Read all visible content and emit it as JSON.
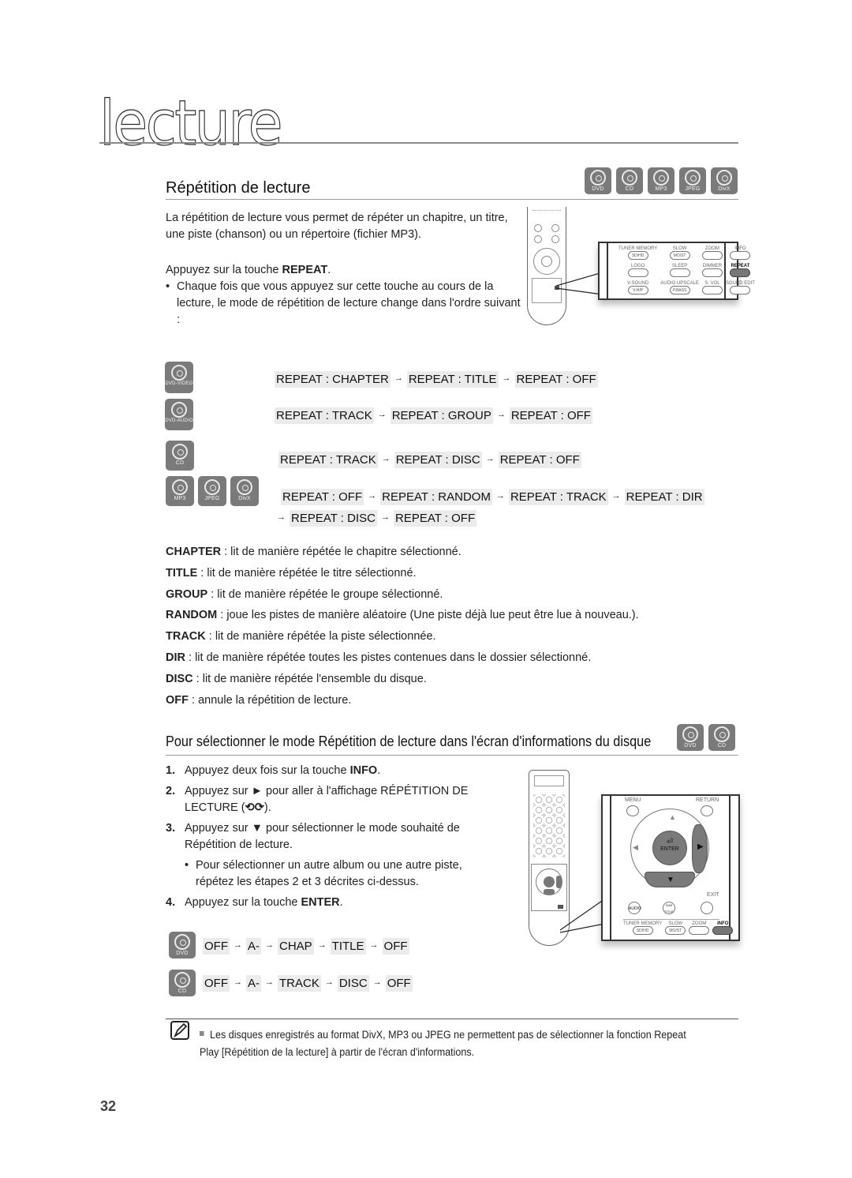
{
  "chapter": {
    "title": "lecture"
  },
  "section": {
    "title": "Répétition de lecture",
    "disc_icons": [
      "DVD",
      "CD",
      "MP3",
      "JPEG",
      "DivX"
    ],
    "intro": "La répétition de lecture vous permet de répéter un chapitre, un titre, une piste (chanson) ou un répertoire (fichier MP3).",
    "press_prefix": "Appuyez sur la touche ",
    "press_key": "REPEAT",
    "press_suffix": ".",
    "bullet": "Chaque fois que vous appuyez sur cette touche au cours de la lecture, le mode de répétition de lecture change dans l'ordre suivant :"
  },
  "remote1": {
    "buttons": [
      {
        "top": "TUNER MEMORY",
        "label": "SD/HD"
      },
      {
        "top": "SLOW",
        "label": "MO/ST"
      },
      {
        "top": "ZOOM",
        "label": ""
      },
      {
        "top": "INFO",
        "label": ""
      },
      {
        "top": "LOGO",
        "label": ""
      },
      {
        "top": "SLEEP",
        "label": ""
      },
      {
        "top": "DIMMER",
        "label": ""
      },
      {
        "top": "REPEAT",
        "label": "",
        "highlight": true
      },
      {
        "top": "V-SOUND",
        "label": "V-H/P"
      },
      {
        "top": "AUDIO UPSCALE",
        "label": "P.BASS"
      },
      {
        "top": "S. VOL",
        "label": ""
      },
      {
        "top": "SOUND EDIT",
        "label": ""
      }
    ]
  },
  "sequences": [
    {
      "disc": "DVD-VIDEO",
      "steps": [
        "REPEAT : CHAPTER",
        "REPEAT : TITLE",
        "REPEAT : OFF"
      ]
    },
    {
      "disc": "DVD-AUDIO",
      "steps": [
        "REPEAT : TRACK",
        "REPEAT : GROUP",
        "REPEAT : OFF"
      ]
    },
    {
      "disc": "CD",
      "steps": [
        "REPEAT : TRACK",
        "REPEAT : DISC",
        "REPEAT : OFF"
      ]
    },
    {
      "discs": [
        "MP3",
        "JPEG",
        "DivX"
      ],
      "steps": [
        "REPEAT : OFF",
        "REPEAT : RANDOM",
        "REPEAT : TRACK",
        "REPEAT : DIR",
        "REPEAT : DISC",
        "REPEAT : OFF"
      ]
    }
  ],
  "definitions": [
    {
      "term": "CHAPTER",
      "text": " : lit de manière répétée le chapitre sélectionné."
    },
    {
      "term": "TITLE",
      "text": " : lit de manière répétée le titre sélectionné."
    },
    {
      "term": "GROUP",
      "text": " : lit de manière répétée le groupe sélectionné."
    },
    {
      "term": "RANDOM",
      "text": " : joue les pistes de manière aléatoire (Une piste déjà lue peut être lue à nouveau.)."
    },
    {
      "term": "TRACK",
      "text": " : lit de manière répétée la piste sélectionnée."
    },
    {
      "term": "DIR",
      "text": " : lit de manière répétée toutes les pistes contenues dans le dossier sélectionné."
    },
    {
      "term": "DISC",
      "text": " : lit de manière répétée l'ensemble du disque."
    },
    {
      "term": "OFF",
      "text": " : annule la répétition de lecture."
    }
  ],
  "subsection": {
    "title": "Pour sélectionner le mode Répétition de lecture dans l'écran d'informations du disque",
    "disc_icons": [
      "DVD",
      "CD"
    ],
    "steps": [
      {
        "num": "1.",
        "pre": "Appuyez deux fois sur la touche ",
        "key": "INFO",
        "post": "."
      },
      {
        "num": "2.",
        "pre": "Appuyez sur ► pour aller à l'affichage RÉPÉTITION DE LECTURE (",
        "key": "⟲⟳",
        "post": ")."
      },
      {
        "num": "3.",
        "pre": "Appuyez sur ▼ pour sélectionner le mode souhaité de Répétition de lecture.",
        "key": "",
        "post": ""
      },
      {
        "num": "•",
        "pre": "Pour sélectionner un autre album ou une autre piste, répétez les étapes 2 et 3 décrites ci-dessus.",
        "key": "",
        "post": "",
        "bullet": true
      },
      {
        "num": "4.",
        "pre": "Appuyez sur la touche ",
        "key": "ENTER",
        "post": "."
      }
    ],
    "info_sequences": [
      {
        "disc": "DVD",
        "steps": [
          "OFF",
          "A-",
          "CHAP",
          "TITLE",
          "OFF"
        ]
      },
      {
        "disc": "CD",
        "steps": [
          "OFF",
          "A-",
          "TRACK",
          "DISC",
          "OFF"
        ]
      }
    ]
  },
  "remote2": {
    "menu": "MENU",
    "return": "RETURN",
    "enter": "ENTER",
    "exit": "EXIT",
    "audio": "AUDIO",
    "subtitle": "SUB TITLE",
    "bottom": [
      {
        "top": "TUNER MEMORY",
        "label": "SD/HD"
      },
      {
        "top": "SLOW",
        "label": "MO/ST"
      },
      {
        "top": "ZOOM",
        "label": ""
      },
      {
        "top": "INFO",
        "label": "",
        "highlight": true
      }
    ]
  },
  "note": {
    "text": "Les disques enregistrés au format DivX, MP3 ou JPEG ne permettent pas de sélectionner la fonction Repeat Play [Répétition de la lecture] à partir de l'écran d'informations."
  },
  "page": {
    "number": "32"
  },
  "arrow_glyph": "→"
}
